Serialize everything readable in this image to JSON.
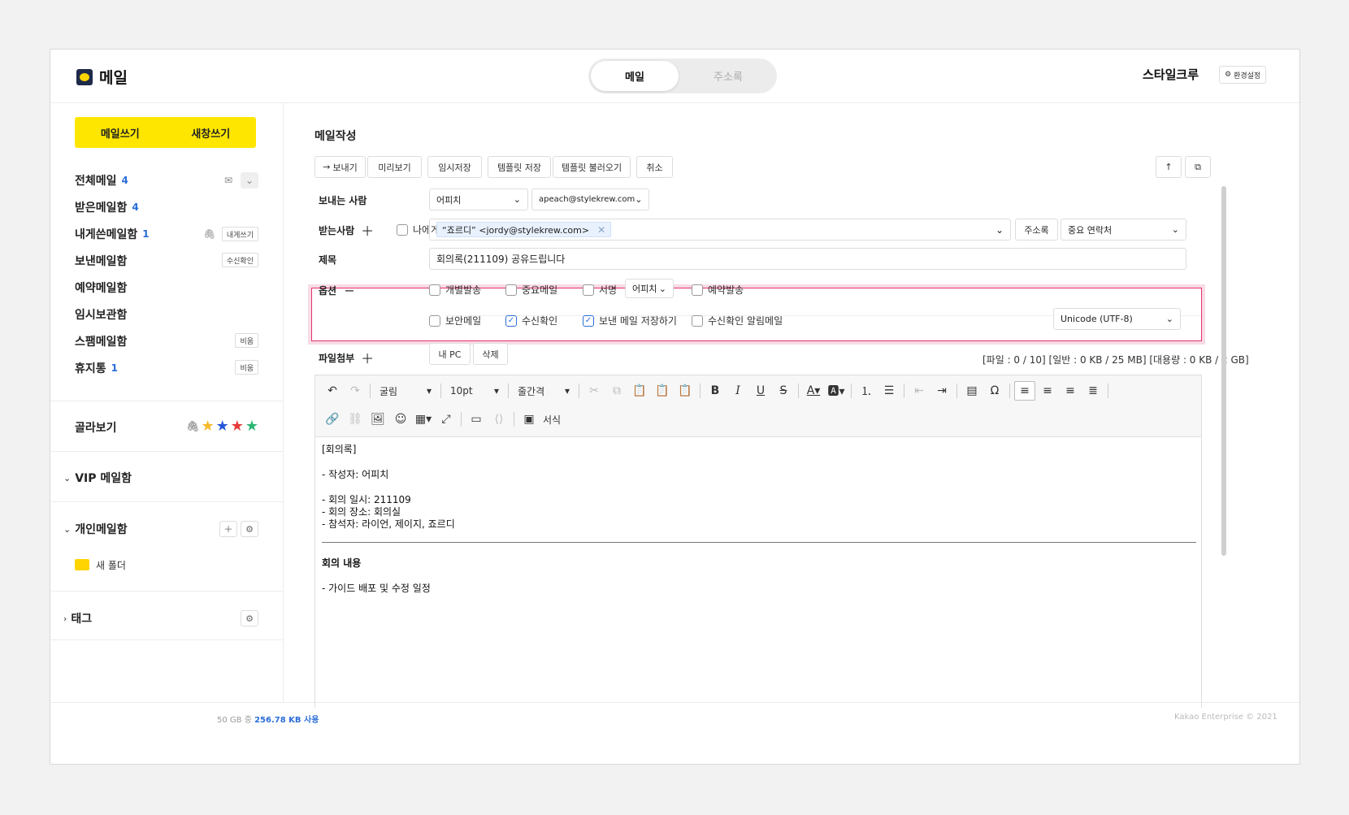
{
  "header": {
    "app_title": "메일",
    "tabs": [
      "메일",
      "주소록"
    ],
    "user_name": "스타일크루",
    "settings_label": "환경설정"
  },
  "sidebar": {
    "compose": "메일쓰기",
    "compose_new_window": "새창쓰기",
    "mailboxes": [
      {
        "label": "전체메일",
        "count": "4"
      },
      {
        "label": "받은메일함",
        "count": "4"
      },
      {
        "label": "내게쓴메일함",
        "count": "1",
        "button": "내게쓰기"
      },
      {
        "label": "보낸메일함",
        "count": "",
        "button": "수신확인"
      },
      {
        "label": "예약메일함",
        "count": ""
      },
      {
        "label": "임시보관함",
        "count": ""
      },
      {
        "label": "스팸메일함",
        "count": "",
        "button": "비움"
      },
      {
        "label": "휴지통",
        "count": "1",
        "button": "비움"
      }
    ],
    "filter_label": "골라보기",
    "star_colors": [
      "#f5b828",
      "#2456d8",
      "#e53935",
      "#2bb673"
    ],
    "vip_label": "VIP 메일함",
    "personal_label": "개인메일함",
    "new_folder": "새 폴더",
    "tag_label": "태그"
  },
  "compose": {
    "title": "메일작성",
    "toolbar": {
      "send": "보내기",
      "preview": "미리보기",
      "draft": "임시저장",
      "template_save": "템플릿 저장",
      "template_load": "템플릿 불러오기",
      "cancel": "취소"
    },
    "from_label": "보내는 사람",
    "from_name": "어피치",
    "from_email": "apeach@stylekrew.com",
    "to_label": "받는사람",
    "to_self": "나에게",
    "to_chip": "“죠르디” <jordy@stylekrew.com>",
    "address_book": "주소록",
    "contacts_select": "중요 연락처",
    "subject_label": "제목",
    "subject_value": "회의록(211109) 공유드립니다",
    "options_label": "옵션",
    "options": {
      "individual": "개별발송",
      "important": "중요메일",
      "signature": "서명",
      "signature_select": "어피치",
      "scheduled": "예약발송",
      "secure": "보안메일",
      "read_receipt": "수신확인",
      "save_sent": "보낸 메일 저장하기",
      "receipt_alert": "수신확인 알림메일",
      "encoding": "Unicode (UTF-8)"
    },
    "attach_label": "파일첨부",
    "my_pc": "내 PC",
    "delete": "삭제",
    "attach_info": "[파일 : 0 / 10] [일반 : 0 KB / 25 MB] [대용량 : 0 KB / 2 GB]"
  },
  "editor": {
    "font": "굴림",
    "size": "10pt",
    "line_height": "줄간격",
    "format": "서식",
    "body": {
      "heading": "[회의록]",
      "author": "- 작성자: 어피치",
      "date": "- 회의 일시: 211109",
      "place": "- 회의 장소: 회의실",
      "attendees": "- 참석자: 라이언, 제이지, 죠르디",
      "section": "회의 내용",
      "item": "- 가이드 배포 및 수정 일정"
    }
  },
  "footer": {
    "storage_prefix": "50 GB 중",
    "storage_used": "256.78 KB 사용",
    "copyright": "Kakao Enterprise © 2021"
  }
}
